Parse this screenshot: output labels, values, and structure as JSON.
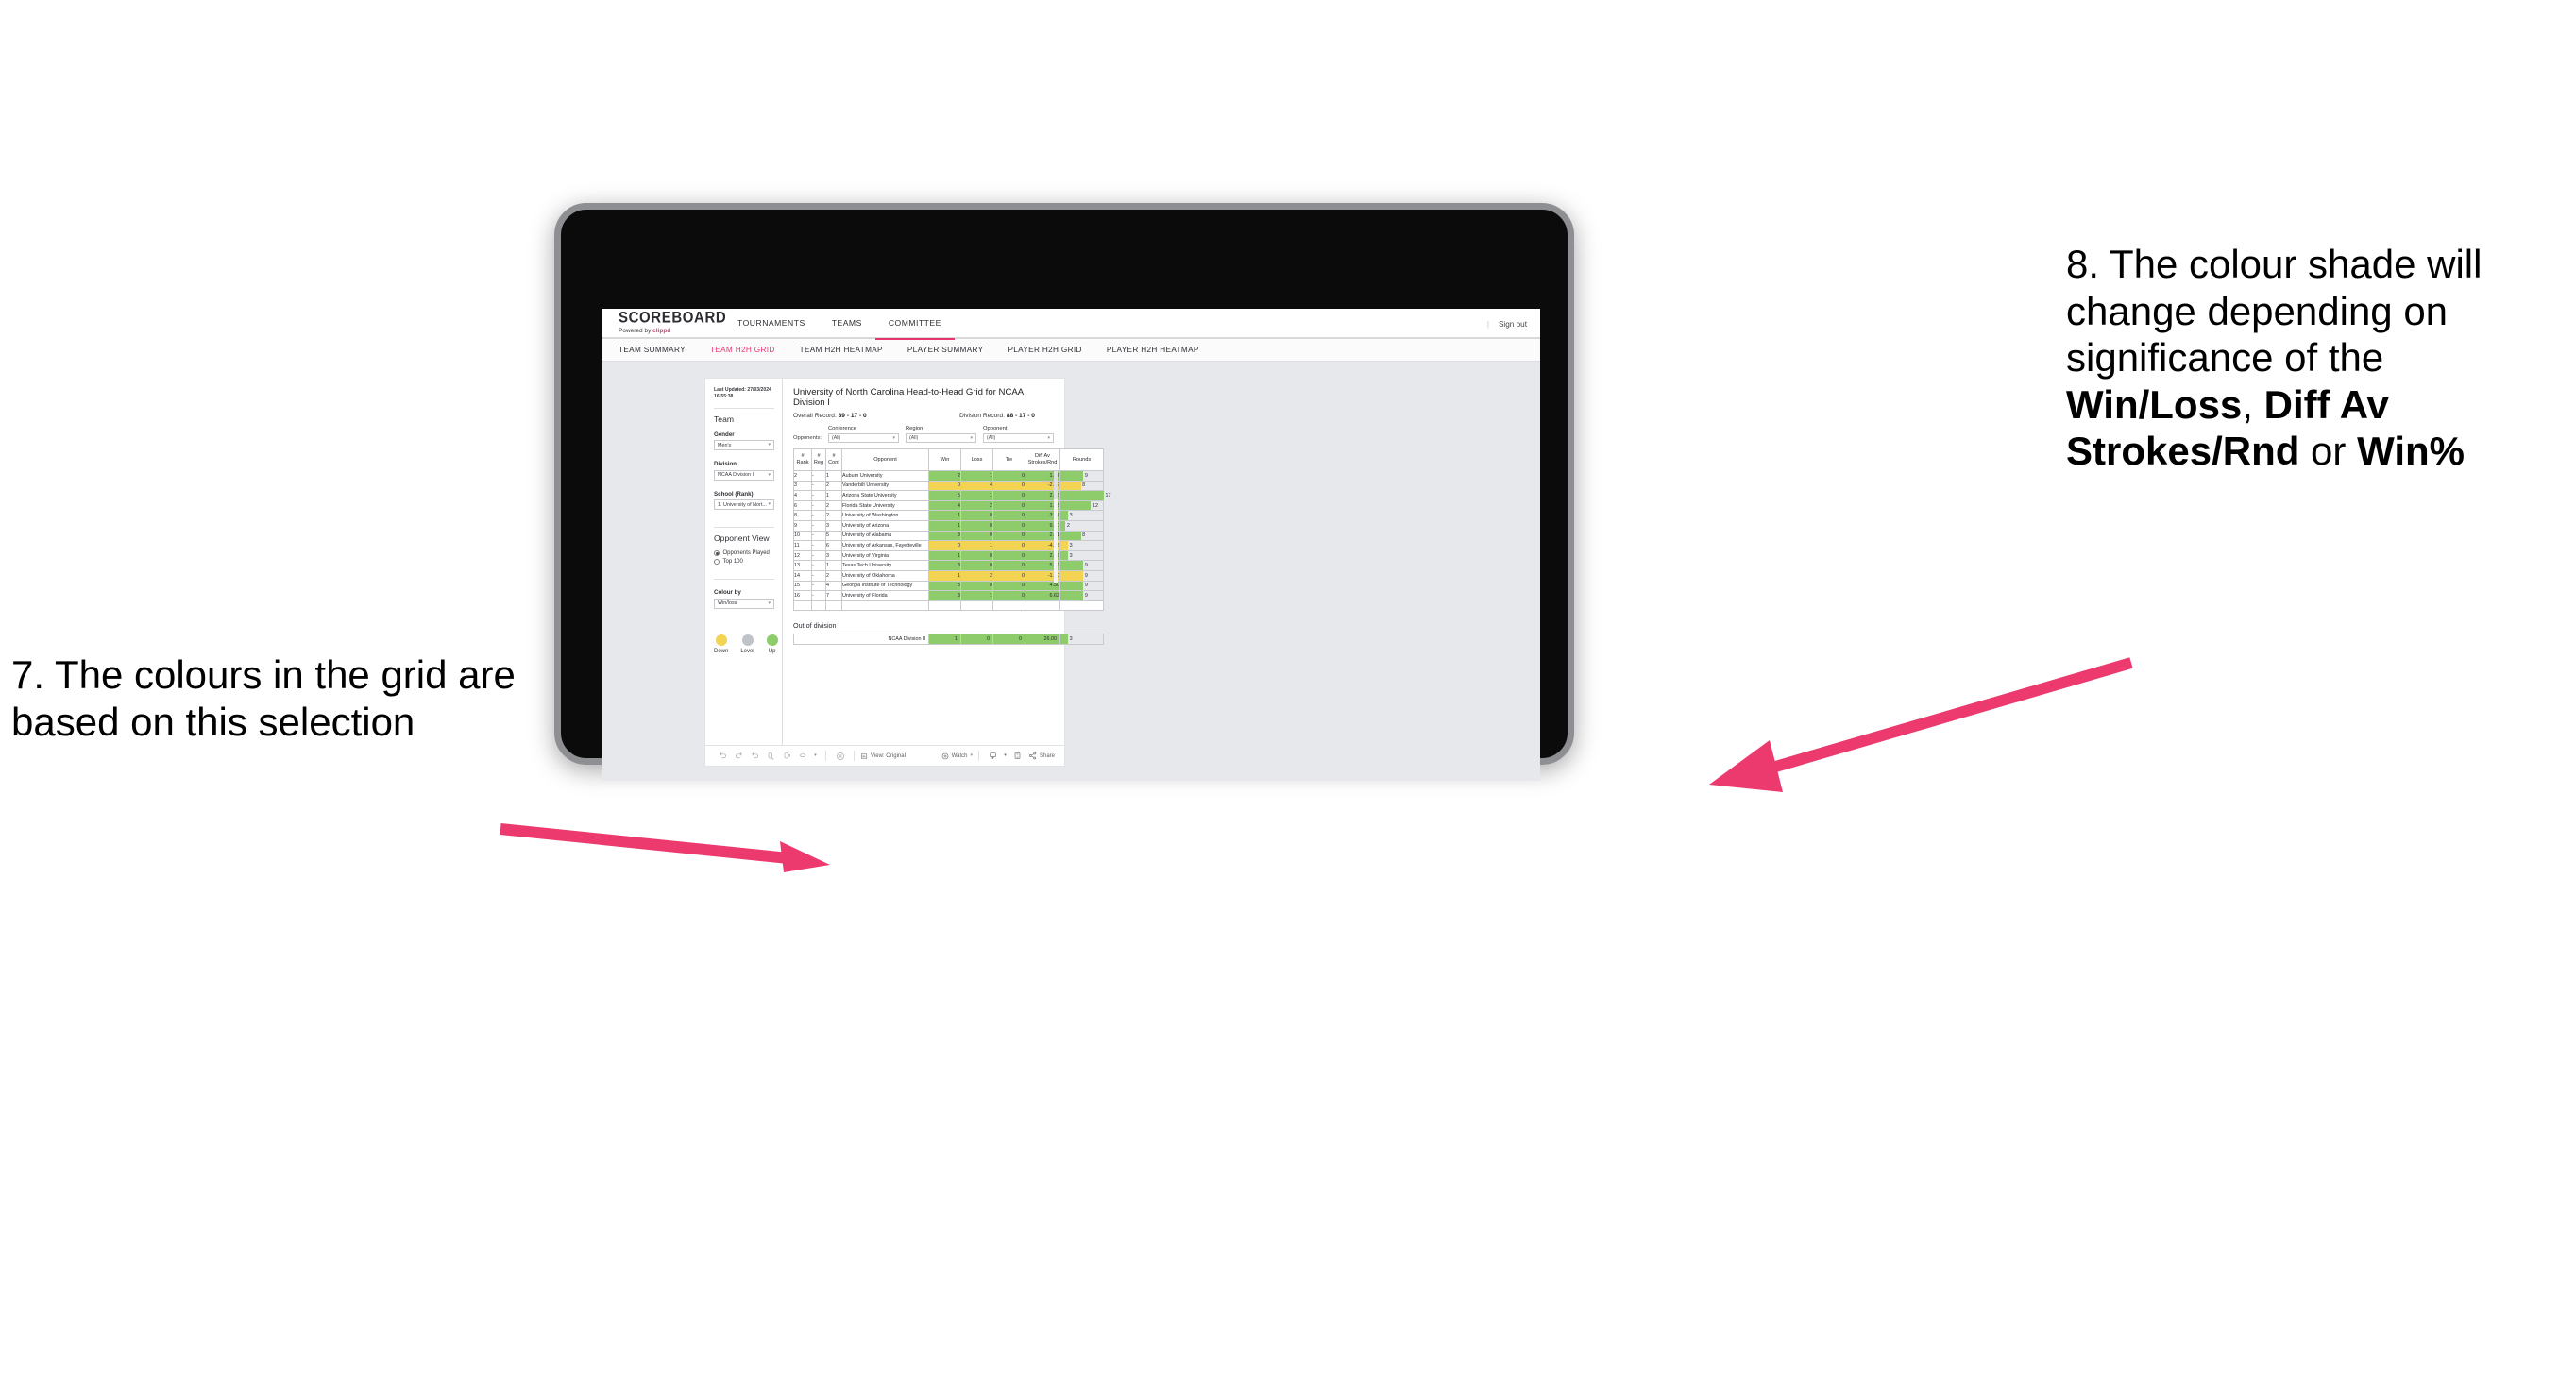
{
  "annotations": {
    "left": "7. The colours in the grid are based on this selection",
    "right_prefix": "8. The colour shade will change depending on significance of the ",
    "right_b1": "Win/Loss",
    "right_mid1": ", ",
    "right_b2": "Diff Av Strokes/Rnd",
    "right_mid2": " or ",
    "right_b3": "Win%",
    "accent_color": "#ec3a6e"
  },
  "app": {
    "brand_title": "SCOREBOARD",
    "brand_sub_pre": "Powered by ",
    "brand_sub_accent": "clippd",
    "sign_out": "Sign out",
    "top_nav": [
      {
        "label": "TOURNAMENTS",
        "active": false
      },
      {
        "label": "TEAMS",
        "active": false
      },
      {
        "label": "COMMITTEE",
        "active": true
      }
    ],
    "sub_nav": [
      {
        "label": "TEAM SUMMARY",
        "active": false
      },
      {
        "label": "TEAM H2H GRID",
        "active": true
      },
      {
        "label": "TEAM H2H HEATMAP",
        "active": false
      },
      {
        "label": "PLAYER SUMMARY",
        "active": false
      },
      {
        "label": "PLAYER H2H GRID",
        "active": false
      },
      {
        "label": "PLAYER H2H HEATMAP",
        "active": false
      }
    ]
  },
  "sidebar": {
    "last_updated": "Last Updated: 27/03/2024 16:55:38",
    "team_heading": "Team",
    "gender_label": "Gender",
    "gender_value": "Men's",
    "division_label": "Division",
    "division_value": "NCAA Division I",
    "school_label": "School (Rank)",
    "school_value": "1. University of Nort...",
    "opponent_view_heading": "Opponent View",
    "opponent_view_options": [
      {
        "label": "Opponents Played",
        "selected": true
      },
      {
        "label": "Top 100",
        "selected": false
      }
    ],
    "colour_by_label": "Colour by",
    "colour_by_value": "Win/loss",
    "legend": [
      {
        "label": "Down",
        "color": "#f2d352"
      },
      {
        "label": "Level",
        "color": "#bfc2c7"
      },
      {
        "label": "Up",
        "color": "#8ecb6a"
      }
    ]
  },
  "main": {
    "title": "University of North Carolina Head-to-Head Grid for NCAA Division I",
    "overall_record_label": "Overall Record: ",
    "overall_record_value": "89 - 17 - 0",
    "division_record_label": "Division Record: ",
    "division_record_value": "88 - 17 - 0",
    "opponents_label": "Opponents:",
    "filters": [
      {
        "label": "Conference",
        "value": "(All)"
      },
      {
        "label": "Region",
        "value": "(All)"
      },
      {
        "label": "Opponent",
        "value": "(All)"
      }
    ],
    "out_of_division_title": "Out of division"
  },
  "chart_data": {
    "type": "table",
    "title": "University of North Carolina Head-to-Head Grid for NCAA Division I",
    "columns": [
      "# Rank",
      "# Reg",
      "# Conf",
      "Opponent",
      "Win",
      "Loss",
      "Tie",
      "Diff Av Strokes/Rnd",
      "Rounds"
    ],
    "column_headers_two_line": [
      {
        "l1": "#",
        "l2": "Rank"
      },
      {
        "l1": "#",
        "l2": "Reg"
      },
      {
        "l1": "#",
        "l2": "Conf"
      },
      {
        "l1": "",
        "l2": "Opponent"
      },
      {
        "l1": "",
        "l2": "Win"
      },
      {
        "l1": "",
        "l2": "Loss"
      },
      {
        "l1": "",
        "l2": "Tie"
      },
      {
        "l1": "Diff Av",
        "l2": "Strokes/Rnd"
      },
      {
        "l1": "",
        "l2": "Rounds"
      }
    ],
    "colour_scale": {
      "up": "#8ecb6a",
      "down": "#f2d352",
      "level": "#bfc2c7"
    },
    "rounds_max": 17,
    "rows": [
      {
        "rank": "2",
        "reg": "-",
        "conf": "1",
        "opponent": "Auburn University",
        "win": "2",
        "loss": "1",
        "tie": "0",
        "diff": "1.67",
        "rounds": "9",
        "rounds_num": 9,
        "state": "up"
      },
      {
        "rank": "3",
        "reg": "-",
        "conf": "2",
        "opponent": "Vanderbilt University",
        "win": "0",
        "loss": "4",
        "tie": "0",
        "diff": "-2.29",
        "rounds": "8",
        "rounds_num": 8,
        "state": "down"
      },
      {
        "rank": "4",
        "reg": "-",
        "conf": "1",
        "opponent": "Arizona State University",
        "win": "5",
        "loss": "1",
        "tie": "0",
        "diff": "2.28",
        "rounds": "17",
        "rounds_num": 17,
        "state": "up"
      },
      {
        "rank": "6",
        "reg": "-",
        "conf": "2",
        "opponent": "Florida State University",
        "win": "4",
        "loss": "2",
        "tie": "0",
        "diff": "1.83",
        "rounds": "12",
        "rounds_num": 12,
        "state": "up"
      },
      {
        "rank": "8",
        "reg": "-",
        "conf": "2",
        "opponent": "University of Washington",
        "win": "1",
        "loss": "0",
        "tie": "0",
        "diff": "3.67",
        "rounds": "3",
        "rounds_num": 3,
        "state": "up"
      },
      {
        "rank": "9",
        "reg": "-",
        "conf": "3",
        "opponent": "University of Arizona",
        "win": "1",
        "loss": "0",
        "tie": "0",
        "diff": "9.00",
        "rounds": "2",
        "rounds_num": 2,
        "state": "up"
      },
      {
        "rank": "10",
        "reg": "-",
        "conf": "5",
        "opponent": "University of Alabama",
        "win": "3",
        "loss": "0",
        "tie": "0",
        "diff": "2.61",
        "rounds": "8",
        "rounds_num": 8,
        "state": "up"
      },
      {
        "rank": "11",
        "reg": "-",
        "conf": "6",
        "opponent": "University of Arkansas, Fayetteville",
        "win": "0",
        "loss": "1",
        "tie": "0",
        "diff": "-4.33",
        "rounds": "3",
        "rounds_num": 3,
        "state": "down"
      },
      {
        "rank": "12",
        "reg": "-",
        "conf": "3",
        "opponent": "University of Virginia",
        "win": "1",
        "loss": "0",
        "tie": "0",
        "diff": "2.33",
        "rounds": "3",
        "rounds_num": 3,
        "state": "up"
      },
      {
        "rank": "13",
        "reg": "-",
        "conf": "1",
        "opponent": "Texas Tech University",
        "win": "3",
        "loss": "0",
        "tie": "0",
        "diff": "5.56",
        "rounds": "9",
        "rounds_num": 9,
        "state": "up"
      },
      {
        "rank": "14",
        "reg": "-",
        "conf": "2",
        "opponent": "University of Oklahoma",
        "win": "1",
        "loss": "2",
        "tie": "0",
        "diff": "-1.00",
        "rounds": "9",
        "rounds_num": 9,
        "state": "down"
      },
      {
        "rank": "15",
        "reg": "-",
        "conf": "4",
        "opponent": "Georgia Institute of Technology",
        "win": "5",
        "loss": "0",
        "tie": "0",
        "diff": "4.50",
        "rounds": "9",
        "rounds_num": 9,
        "state": "up"
      },
      {
        "rank": "16",
        "reg": "-",
        "conf": "7",
        "opponent": "University of Florida",
        "win": "3",
        "loss": "1",
        "tie": "0",
        "diff": "6.62",
        "rounds": "9",
        "rounds_num": 9,
        "state": "up"
      }
    ],
    "out_of_division_rows": [
      {
        "opponent": "NCAA Division II",
        "win": "1",
        "loss": "0",
        "tie": "0",
        "diff": "26.00",
        "rounds": "3",
        "rounds_num": 3,
        "state": "up"
      }
    ]
  },
  "toolbar": {
    "view_label": "View: Original",
    "watch_label": "Watch",
    "share_label": "Share"
  }
}
